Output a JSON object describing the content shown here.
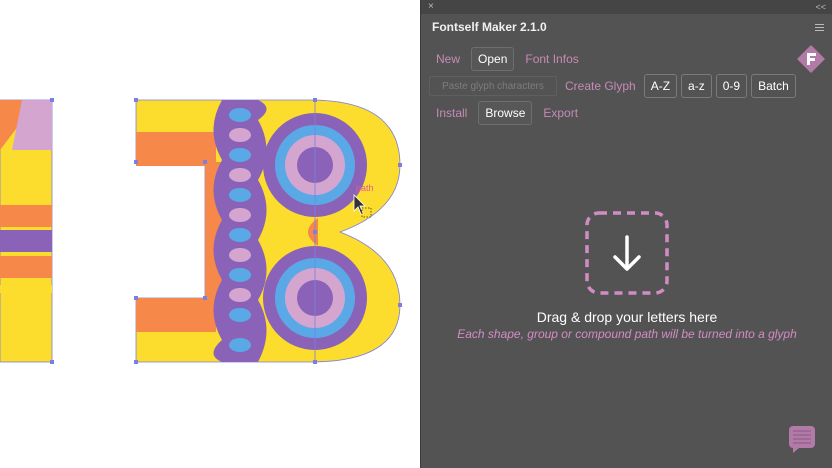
{
  "canvas": {
    "cursor_tooltip": "path"
  },
  "panel": {
    "title": "Fontself Maker 2.1.0",
    "close_glyph": "×",
    "collapse_glyph": "<<",
    "menu_icon": "hamburger-icon",
    "tabs_row1": [
      {
        "label": "New",
        "active": false
      },
      {
        "label": "Open",
        "active": true
      },
      {
        "label": "Font Infos",
        "active": false
      }
    ],
    "glyph_row": {
      "faded_input": "Paste glyph characters",
      "create_glyph_label": "Create Glyph",
      "buttons": [
        "A-Z",
        "a-z",
        "0-9",
        "Batch"
      ]
    },
    "tabs_row3": [
      {
        "label": "Install",
        "active": false
      },
      {
        "label": "Browse",
        "active": true
      },
      {
        "label": "Export",
        "active": false
      }
    ],
    "drop": {
      "title": "Drag & drop your letters here",
      "subtitle": "Each shape, group or compound path will be turned into a glyph",
      "icon": "download-arrow-icon"
    },
    "colors": {
      "panel_bg": "#535353",
      "accent_pink": "#c48bb6",
      "art_yellow": "#fcdc2c",
      "art_orange": "#f6884a",
      "art_purple": "#8a63b8",
      "art_lilac": "#d4a6cf",
      "art_blue": "#5aa9e6"
    }
  }
}
